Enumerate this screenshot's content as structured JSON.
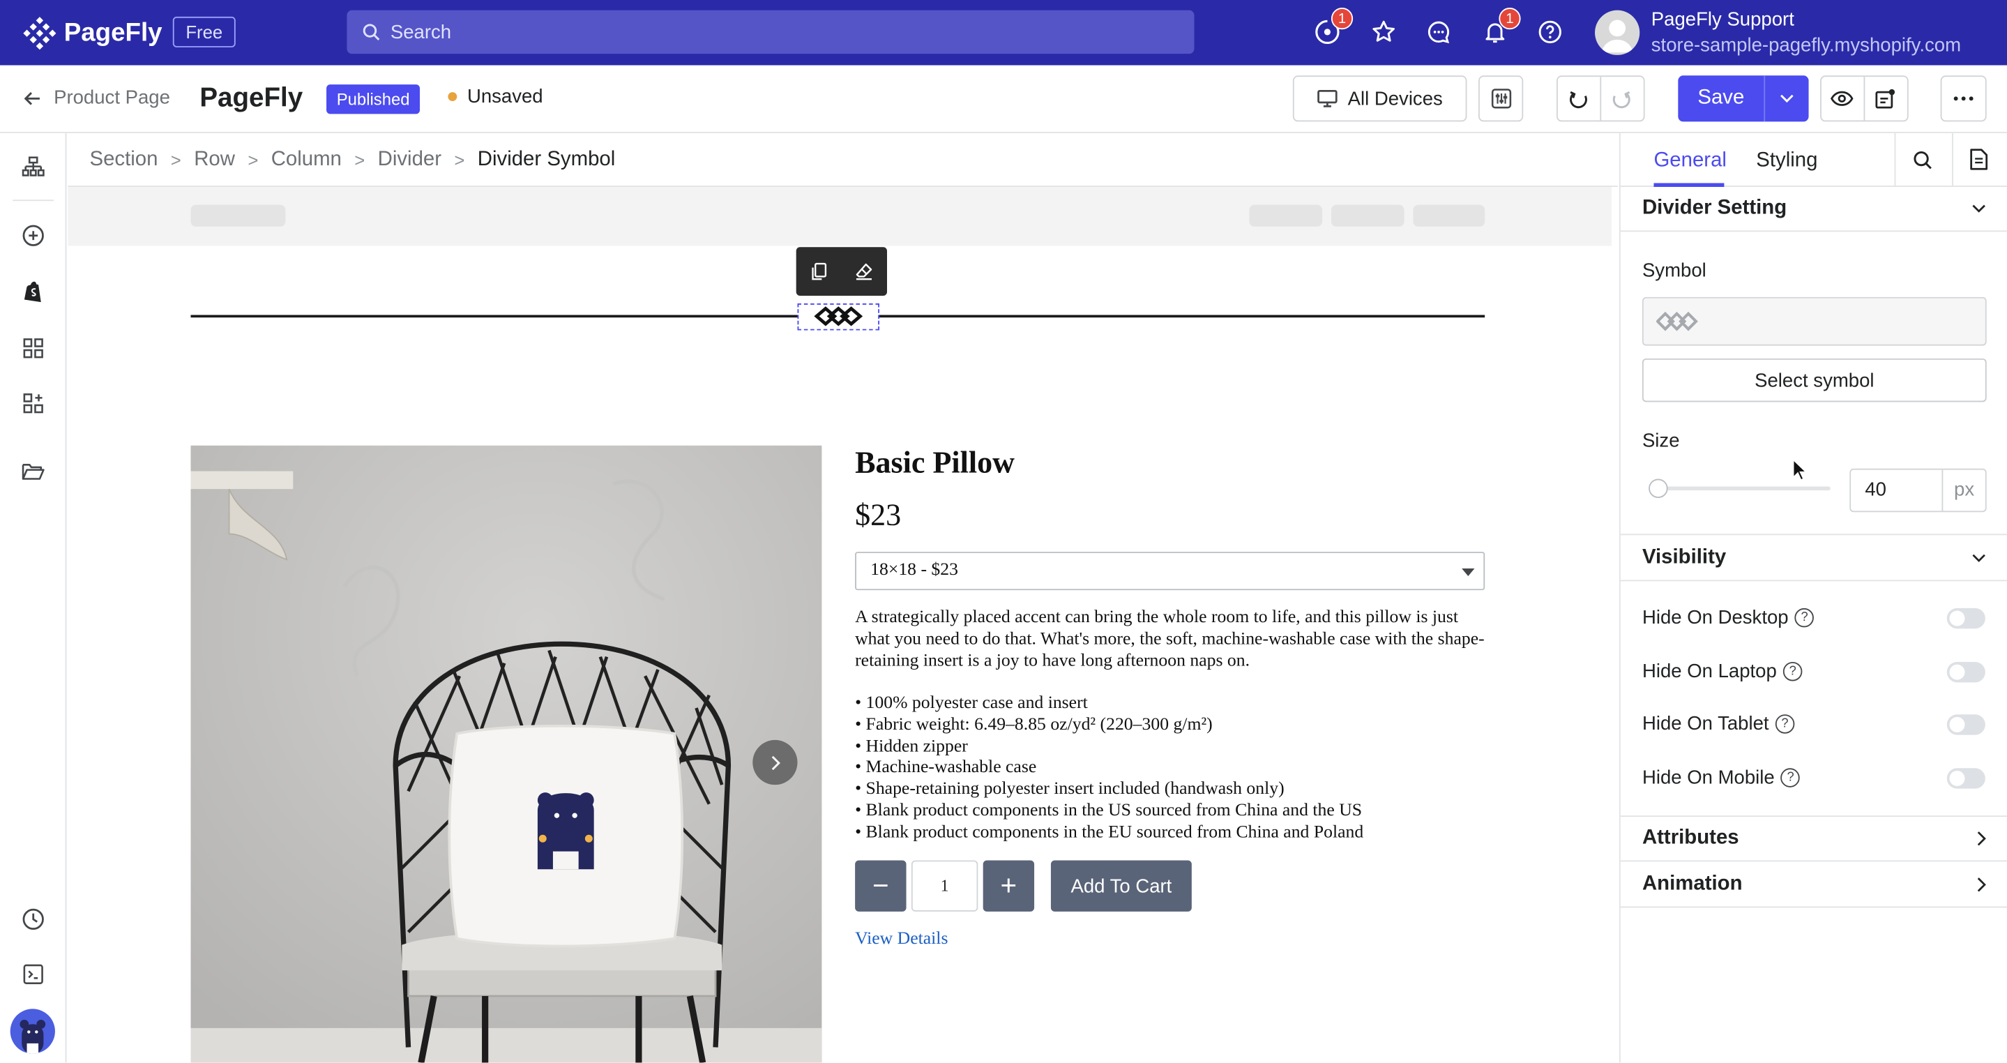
{
  "app": {
    "name": "PageFly",
    "plan": "Free"
  },
  "topbar": {
    "search_placeholder": "Search",
    "notif_badge_1": "1",
    "notif_badge_2": "1",
    "user_name": "PageFly Support",
    "shop": "store-sample-pagefly.myshopify.com"
  },
  "header": {
    "back_label": "Product Page",
    "brand": "PageFly",
    "status": "Published",
    "unsaved": "Unsaved",
    "devices": "All Devices",
    "save": "Save"
  },
  "breadcrumb": [
    "Section",
    "Row",
    "Column",
    "Divider",
    "Divider Symbol"
  ],
  "product": {
    "title": "Basic Pillow",
    "price": "$23",
    "variant": "18×18 - $23",
    "description": "A strategically placed accent can bring the whole room to life, and this pillow is just what you need to do that. What's more, the soft, machine-washable case with the shape-retaining insert is a joy to have long afternoon naps on.",
    "bullets": [
      "• 100% polyester case and insert",
      "• Fabric weight: 6.49–8.85 oz/yd² (220–300 g/m²)",
      "• Hidden zipper",
      "• Machine-washable case",
      "• Shape-retaining polyester insert included (handwash only)",
      "• Blank product components in the US sourced from China and the US",
      "• Blank product components in the EU sourced from China and Poland"
    ],
    "qty": "1",
    "minus": "−",
    "plus": "+",
    "add_to_cart": "Add To Cart",
    "view_details": "View Details"
  },
  "panel": {
    "tabs": [
      "General",
      "Styling"
    ],
    "divider_setting": "Divider Setting",
    "symbol_label": "Symbol",
    "select_symbol": "Select symbol",
    "size_label": "Size",
    "size_value": "40",
    "size_unit": "px",
    "size_slider_fraction": 0.0,
    "visibility": "Visibility",
    "vis_items": [
      "Hide On Desktop",
      "Hide On Laptop",
      "Hide On Tablet",
      "Hide On Mobile"
    ],
    "vis_states": [
      false,
      false,
      false,
      false
    ],
    "attributes": "Attributes",
    "animation": "Animation"
  },
  "colors": {
    "topbar": "#2a2aa8",
    "accent": "#4b4bf0",
    "published": "#4b4bf0",
    "unsaved_dot": "#e8a33d",
    "button_dark": "#5a6478",
    "link": "#1a5fc4"
  },
  "icons": [
    "pagefly-logo",
    "search-icon",
    "tasks-icon",
    "star-icon",
    "chat-icon",
    "bell-icon",
    "help-icon",
    "arrow-left-icon",
    "monitor-icon",
    "sliders-icon",
    "undo-icon",
    "redo-icon",
    "chevron-down-icon",
    "eye-icon",
    "publish-icon",
    "more-icon",
    "layers-icon",
    "add-icon",
    "shopify-icon",
    "grid-icon",
    "apps-icon",
    "folder-icon",
    "history-icon",
    "terminal-icon",
    "copy-icon",
    "clear-format-icon",
    "chevron-right-icon",
    "divider-symbol-icon"
  ]
}
